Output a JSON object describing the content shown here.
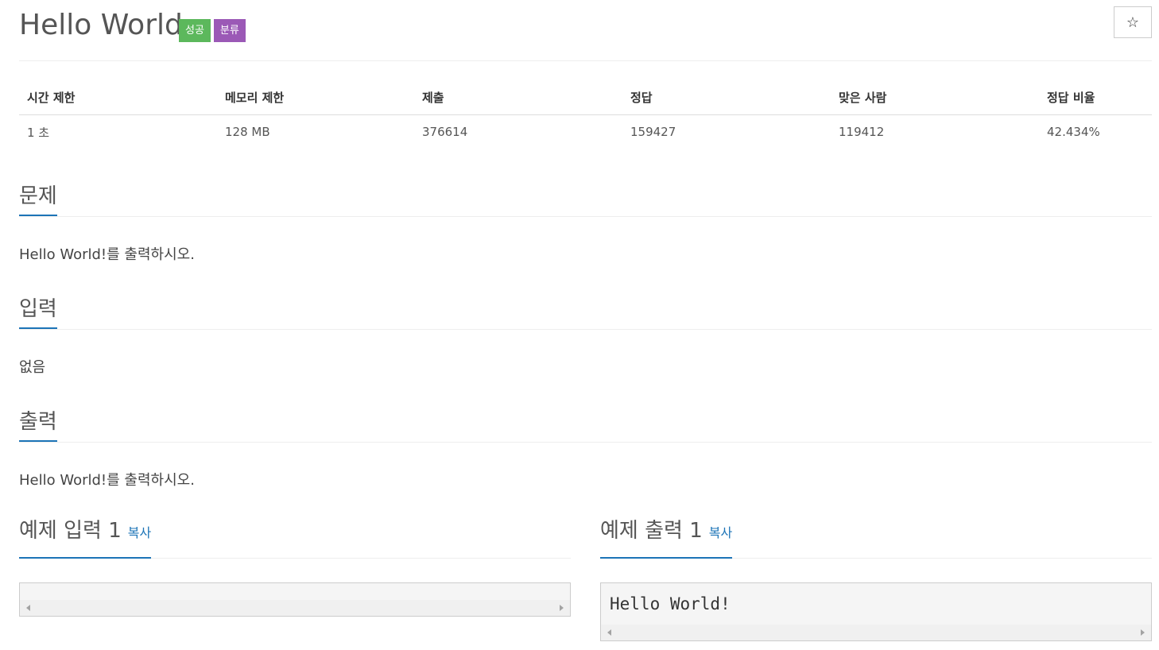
{
  "header": {
    "title": "Hello World",
    "badges": [
      {
        "label": "성공",
        "color": "#5cb85c"
      },
      {
        "label": "분류",
        "color": "#9b59b6"
      }
    ],
    "star_icon": "☆"
  },
  "stats": {
    "headers": [
      "시간 제한",
      "메모리 제한",
      "제출",
      "정답",
      "맞은 사람",
      "정답 비율"
    ],
    "values": [
      "1 초",
      "128 MB",
      "376614",
      "159427",
      "119412",
      "42.434%"
    ]
  },
  "sections": {
    "problem": {
      "title": "문제",
      "body": "Hello World!를 출력하시오."
    },
    "input": {
      "title": "입력",
      "body": "없음"
    },
    "output": {
      "title": "출력",
      "body": "Hello World!를 출력하시오."
    }
  },
  "samples": {
    "input": {
      "title": "예제 입력 1",
      "copy_label": "복사",
      "content": ""
    },
    "output": {
      "title": "예제 출력 1",
      "copy_label": "복사",
      "content": "Hello World!"
    }
  },
  "colors": {
    "accent": "#1c74b7",
    "success": "#5cb85c",
    "category": "#9b59b6"
  }
}
